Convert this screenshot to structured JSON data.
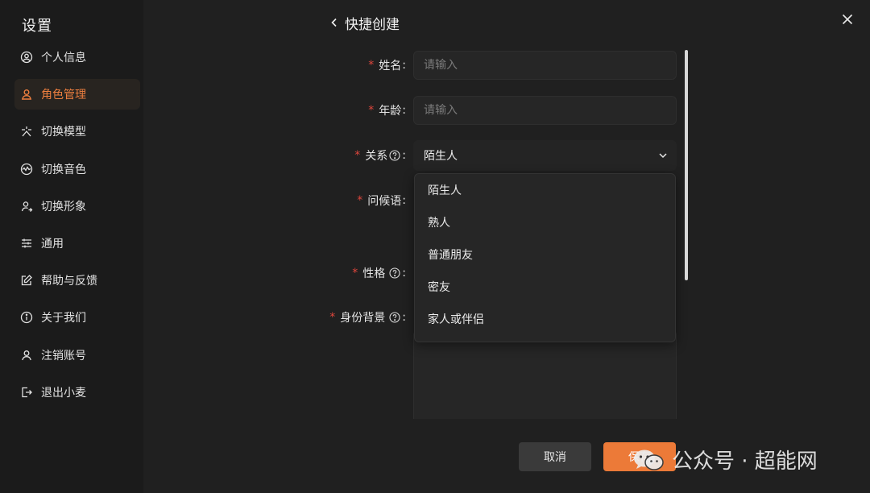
{
  "sidebar": {
    "title": "设置",
    "items": [
      {
        "label": "个人信息",
        "icon": "user-circle-icon",
        "active": false
      },
      {
        "label": "角色管理",
        "icon": "person-icon",
        "active": true
      },
      {
        "label": "切换模型",
        "icon": "model-icon",
        "active": false
      },
      {
        "label": "切换音色",
        "icon": "voice-icon",
        "active": false
      },
      {
        "label": "切换形象",
        "icon": "avatar-switch-icon",
        "active": false
      },
      {
        "label": "通用",
        "icon": "sliders-icon",
        "active": false
      },
      {
        "label": "帮助与反馈",
        "icon": "edit-icon",
        "active": false
      },
      {
        "label": "关于我们",
        "icon": "info-icon",
        "active": false
      },
      {
        "label": "注销账号",
        "icon": "user-off-icon",
        "active": false
      },
      {
        "label": "退出小麦",
        "icon": "logout-icon",
        "active": false
      }
    ]
  },
  "header": {
    "title": "快捷创建"
  },
  "form": {
    "name": {
      "label": "姓名",
      "placeholder": "请输入"
    },
    "age": {
      "label": "年龄",
      "placeholder": "请输入"
    },
    "relation": {
      "label": "关系",
      "selected": "陌生人",
      "options": [
        "陌生人",
        "熟人",
        "普通朋友",
        "密友",
        "家人或伴侣"
      ]
    },
    "greeting": {
      "label": "问候语"
    },
    "personality": {
      "label": "性格"
    },
    "background": {
      "label": "身份背景"
    },
    "required_mark": "*",
    "colon": ":"
  },
  "actions": {
    "cancel": "取消",
    "save": "保存"
  },
  "watermark": {
    "text": "公众号 · 超能网"
  },
  "colors": {
    "accent": "#ec7a38",
    "background": "#202020",
    "sidebar": "#1b1b1b",
    "required": "#e0463c"
  }
}
